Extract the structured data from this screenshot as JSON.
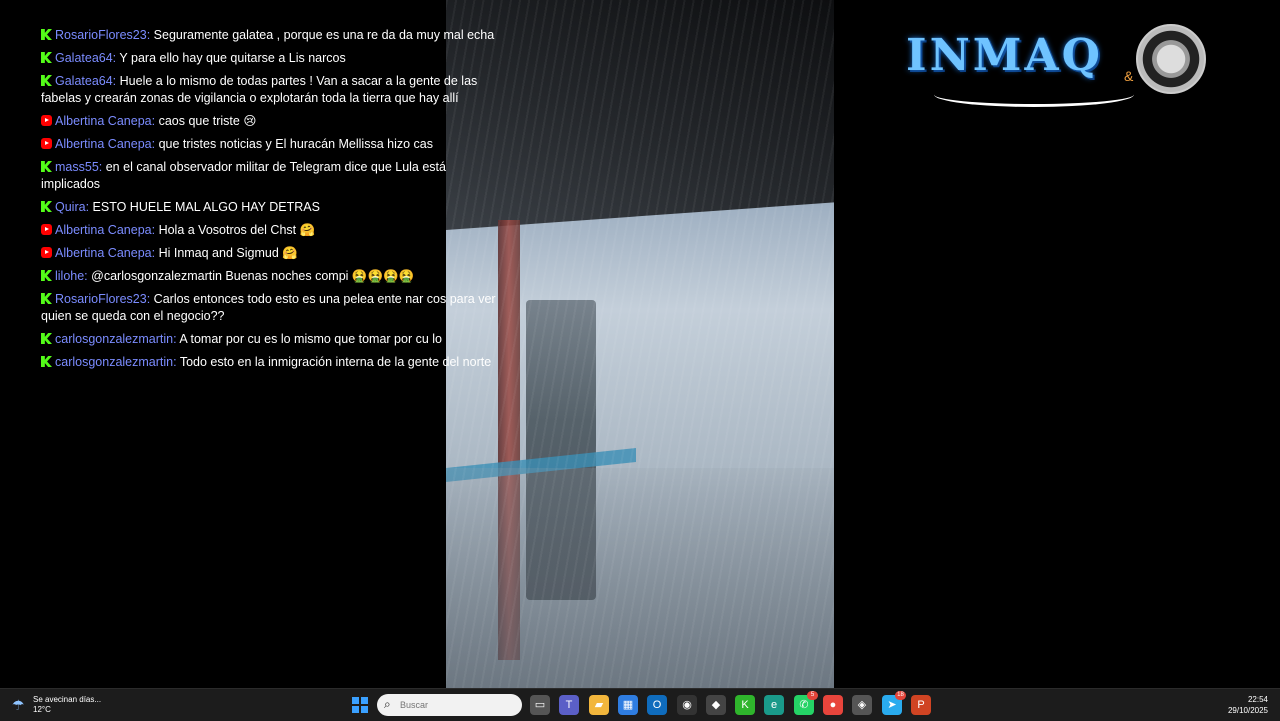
{
  "chat": {
    "messages": [
      {
        "platform": "kick",
        "user": "RosarioFlores23:",
        "text": "Seguramente galatea , porque es una re da da muy mal echa"
      },
      {
        "platform": "kick",
        "user": "Galatea64:",
        "text": "Y para ello hay que quitarse a Lis narcos"
      },
      {
        "platform": "kick",
        "user": "Galatea64:",
        "text": "Huele a lo mismo de todas partes ! Van a sacar a la gente de las fabelas y crearán zonas de vigilancia o explotarán toda la tierra que hay allí"
      },
      {
        "platform": "youtube",
        "user": "Albertina Canepa:",
        "text": "caos que triste 😢"
      },
      {
        "platform": "youtube",
        "user": "Albertina Canepa:",
        "text": "que tristes noticias y El huracán Mellissa hizo cas"
      },
      {
        "platform": "kick",
        "user": "mass55:",
        "text": "en el canal observador militar de Telegram dice que Lula está implicados"
      },
      {
        "platform": "kick",
        "user": "Quira:",
        "text": "ESTO HUELE MAL ALGO HAY DETRAS"
      },
      {
        "platform": "youtube",
        "user": "Albertina Canepa:",
        "text": "Hola a Vosotros del Chst 🤗"
      },
      {
        "platform": "youtube",
        "user": "Albertina Canepa:",
        "text": "Hi Inmaq and Sigmud 🤗"
      },
      {
        "platform": "kick",
        "user": "lilohe:",
        "text": "@carlosgonzalezmartin Buenas noches compi 🤮🤮🤮🤮"
      },
      {
        "platform": "kick",
        "user": "RosarioFlores23:",
        "text": "Carlos entonces todo esto es una pelea ente nar cos para ver quien se queda con el negocio??"
      },
      {
        "platform": "kick",
        "user": "carlosgonzalezmartin:",
        "text": "A tomar por cu es lo mismo que tomar por cu lo"
      },
      {
        "platform": "kick",
        "user": "carlosgonzalezmartin:",
        "text": "Todo esto en la inmigración interna de la gente del norte"
      }
    ]
  },
  "logo": {
    "text": "INMAQ",
    "amp": "&"
  },
  "taskbar": {
    "weather": {
      "icon": "rain-umbrella-icon",
      "text": "Se avecinan días...",
      "temp": "12°C"
    },
    "search_placeholder": "Buscar",
    "apps": [
      {
        "name": "task-view",
        "icon": "task-view-icon"
      },
      {
        "name": "teams",
        "icon": "teams-icon"
      },
      {
        "name": "file-explorer",
        "icon": "folder-icon"
      },
      {
        "name": "store",
        "icon": "store-icon"
      },
      {
        "name": "outlook",
        "icon": "outlook-icon"
      },
      {
        "name": "obs",
        "icon": "obs-icon"
      },
      {
        "name": "unity",
        "icon": "unity-icon"
      },
      {
        "name": "kick",
        "icon": "kick-icon"
      },
      {
        "name": "edge",
        "icon": "edge-icon"
      },
      {
        "name": "whatsapp",
        "icon": "whatsapp-icon",
        "badge": "5"
      },
      {
        "name": "chrome",
        "icon": "chrome-icon"
      },
      {
        "name": "security",
        "icon": "shield-icon"
      },
      {
        "name": "telegram",
        "icon": "telegram-icon",
        "badge": "18"
      },
      {
        "name": "powerpoint",
        "icon": "powerpoint-icon"
      }
    ],
    "time": "22:54",
    "date": "29/10/2025"
  },
  "colors": {
    "username": "#7b8cff",
    "kick": "#53fc18",
    "youtube": "#ff0000",
    "taskbar": "#1c1c1c"
  }
}
